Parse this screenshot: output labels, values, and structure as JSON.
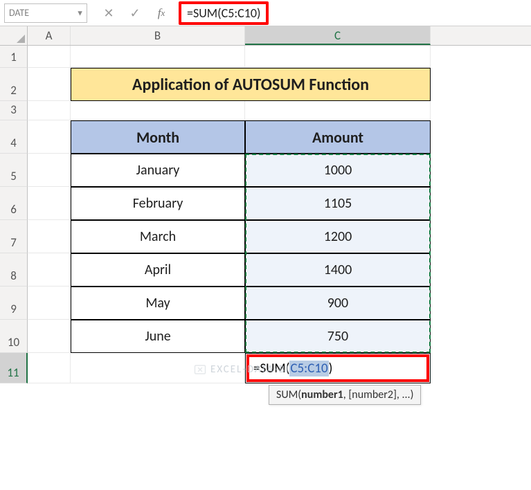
{
  "formula_bar": {
    "name_box": "DATE",
    "formula": "=SUM(C5:C10)"
  },
  "columns": [
    "A",
    "B",
    "C"
  ],
  "rows": [
    "1",
    "2",
    "3",
    "4",
    "5",
    "6",
    "7",
    "8",
    "9",
    "10",
    "11"
  ],
  "title": "Application of AUTOSUM Function",
  "table": {
    "headers": {
      "month": "Month",
      "amount": "Amount"
    },
    "rows": [
      {
        "month": "January",
        "amount": "1000"
      },
      {
        "month": "February",
        "amount": "1105"
      },
      {
        "month": "March",
        "amount": "1200"
      },
      {
        "month": "April",
        "amount": "1400"
      },
      {
        "month": "May",
        "amount": "900"
      },
      {
        "month": "June",
        "amount": "750"
      }
    ]
  },
  "active_cell": {
    "prefix": "=SUM(",
    "range": "C5:C10",
    "suffix": ")"
  },
  "tooltip": {
    "fn": "SUM(",
    "arg1": "number1",
    "rest": ", [number2], ...)"
  },
  "watermark": "EXCEL-DATA-BI",
  "chart_data": {
    "type": "table",
    "title": "Application of AUTOSUM Function",
    "columns": [
      "Month",
      "Amount"
    ],
    "rows": [
      [
        "January",
        1000
      ],
      [
        "February",
        1105
      ],
      [
        "March",
        1200
      ],
      [
        "April",
        1400
      ],
      [
        "May",
        900
      ],
      [
        "June",
        750
      ]
    ],
    "formula": "=SUM(C5:C10)",
    "formula_cell": "C11",
    "selected_range": "C5:C10"
  }
}
